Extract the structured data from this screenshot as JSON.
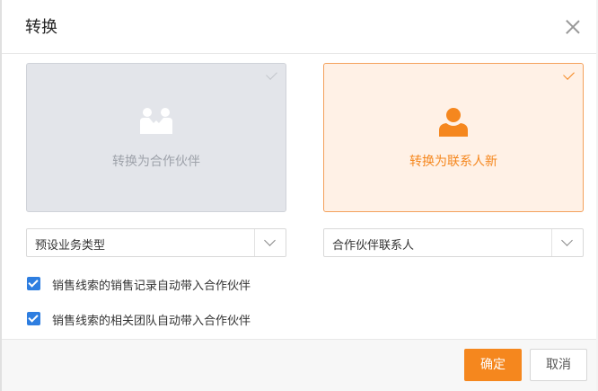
{
  "dialog": {
    "title": "转换",
    "close_icon": "close-icon"
  },
  "cards": [
    {
      "label": "转换为合作伙伴",
      "icon": "handshake-icon",
      "selected": false
    },
    {
      "label": "转换为联系人新",
      "icon": "person-icon",
      "selected": true
    }
  ],
  "selects": {
    "left": {
      "value": "预设业务类型"
    },
    "right": {
      "value": "合作伙伴联系人"
    }
  },
  "checkboxes": [
    {
      "label": "销售线索的销售记录自动带入合作伙伴",
      "checked": true
    },
    {
      "label": "销售线索的相关团队自动带入合作伙伴",
      "checked": true
    }
  ],
  "footer": {
    "ok_label": "确定",
    "cancel_label": "取消"
  },
  "colors": {
    "accent": "#f5871e",
    "checkbox": "#2e7ee0",
    "card_inactive_bg": "#e3e5ea",
    "card_active_bg": "#fff1e6"
  }
}
